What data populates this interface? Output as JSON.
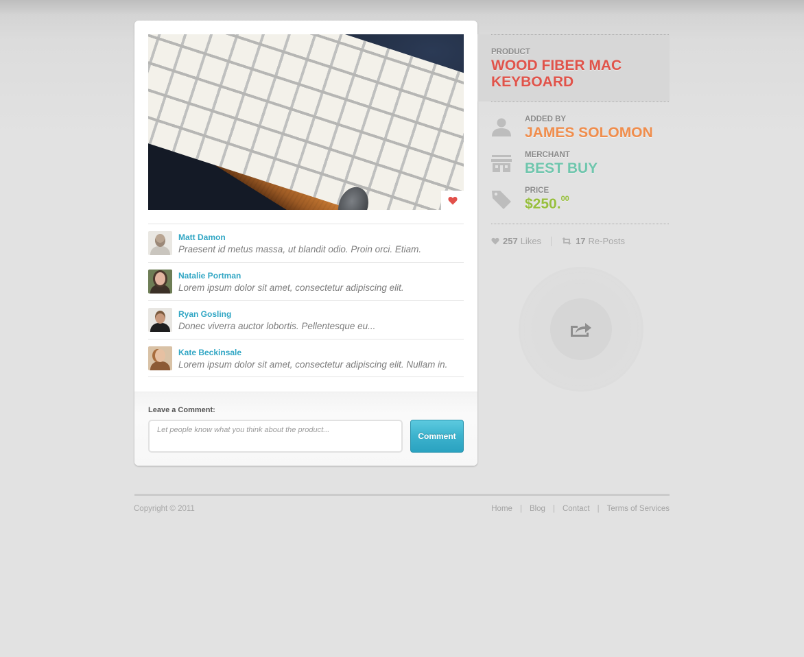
{
  "product": {
    "eyebrow": "PRODUCT",
    "title": "WOOD FIBER MAC KEYBOARD",
    "image_alt": "Wooden Mac keyboard",
    "added_by_label": "ADDED BY",
    "added_by": "JAMES SOLOMON",
    "merchant_label": "MERCHANT",
    "merchant": "BEST BUY",
    "price_label": "PRICE",
    "price_main": "$250.",
    "price_cents": "00"
  },
  "stats": {
    "likes_count": "257",
    "likes_label": "Likes",
    "reposts_count": "17",
    "reposts_label": "Re-Posts"
  },
  "comments": [
    {
      "name": "Matt Damon",
      "text": "Praesent id metus massa, ut blandit odio. Proin orci. Etiam."
    },
    {
      "name": "Natalie Portman",
      "text": "Lorem ipsum dolor sit amet, consectetur adipiscing elit."
    },
    {
      "name": "Ryan Gosling",
      "text": "Donec viverra auctor lobortis. Pellentesque eu..."
    },
    {
      "name": "Kate Beckinsale",
      "text": "Lorem ipsum dolor sit amet, consectetur adipiscing elit. Nullam in."
    }
  ],
  "comment_form": {
    "label": "Leave a Comment:",
    "placeholder": "Let people know what you think about the product...",
    "value": "",
    "button": "Comment"
  },
  "footer": {
    "copyright": "Copyright © 2011",
    "links": [
      "Home",
      "Blog",
      "Contact",
      "Terms of Services"
    ]
  },
  "colors": {
    "title_red": "#e0534a",
    "added_by_orange": "#f08d4c",
    "merchant_teal": "#6fc6ad",
    "price_green": "#97bf3c",
    "commenter_blue": "#31a6c4",
    "button_blue": "#3cb2cd",
    "heart_red": "#e2504a"
  },
  "icons": {
    "like_badge": "heart-icon",
    "added_by": "user-icon",
    "merchant": "store-icon",
    "price": "tag-icon",
    "likes": "heart-icon",
    "reposts": "repost-icon",
    "share": "share-icon"
  }
}
